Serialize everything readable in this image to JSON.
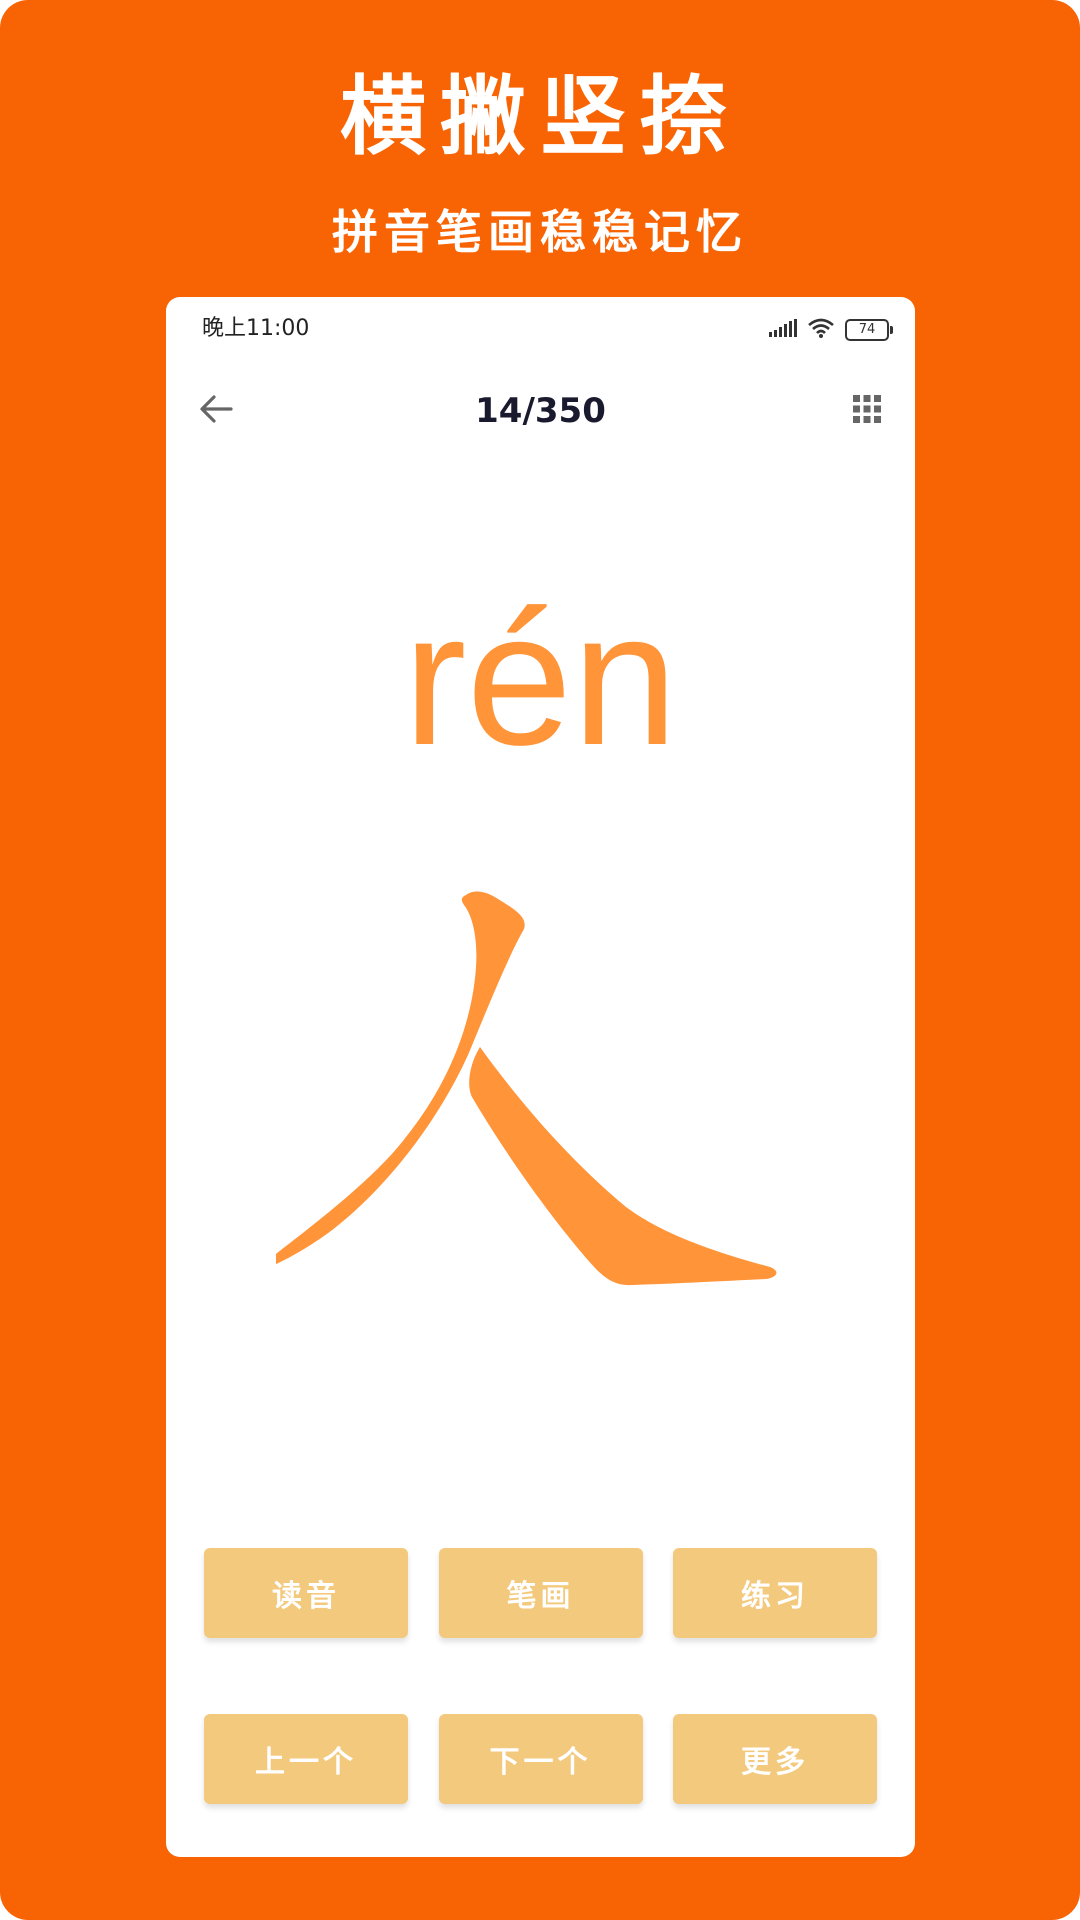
{
  "promo": {
    "headline": "横撇竖捺",
    "subheadline": "拼音笔画稳稳记忆"
  },
  "status_bar": {
    "time": "晚上11:00",
    "battery": "74"
  },
  "nav": {
    "counter": "14/350"
  },
  "card": {
    "pinyin": "rén",
    "character": "人"
  },
  "actions": {
    "row1": [
      "读音",
      "笔画",
      "练习"
    ],
    "row2": [
      "上一个",
      "下一个",
      "更多"
    ]
  },
  "colors": {
    "background": "#F86404",
    "pinyin": "#FF9438",
    "character": "#FF9438",
    "button": "#F3C97D"
  },
  "icons": {
    "back": "arrow-left-icon",
    "grid": "grid-menu-icon",
    "signal": "signal-icon",
    "wifi": "wifi-icon",
    "battery": "battery-icon"
  }
}
